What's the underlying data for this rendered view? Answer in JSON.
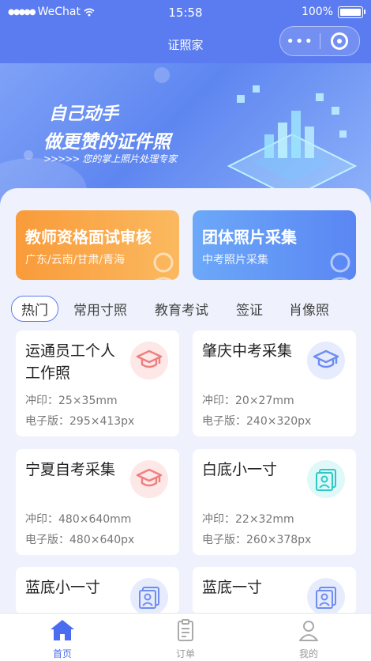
{
  "status": {
    "carrier": "WeChat",
    "time": "15:58",
    "battery": "100%"
  },
  "nav": {
    "title": "证照家",
    "more": "•••"
  },
  "banner": {
    "slogan_line1": "自己动手",
    "slogan_line2": "做更赞的证件照",
    "arrows": ">>>>>",
    "tagline": "您的掌上照片处理专家"
  },
  "promos": [
    {
      "title": "教师资格面试审核",
      "subtitle": "广东/云南/甘肃/青海",
      "color": "#f99b3a"
    },
    {
      "title": "团体照片采集",
      "subtitle": "中考照片采集",
      "color": "#5a86f3"
    }
  ],
  "tabs": [
    "热门",
    "常用寸照",
    "教育考试",
    "签证",
    "肖像照"
  ],
  "cards": [
    {
      "name": "运通员工个人工作照",
      "print": "冲印：25×35mm",
      "digital": "电子版：295×413px",
      "icon": "graduation-cap-icon",
      "icon_color": "#ef7f7f"
    },
    {
      "name": "肇庆中考采集",
      "print": "冲印：20×27mm",
      "digital": "电子版：240×320px",
      "icon": "graduation-cap-icon",
      "icon_color": "#6f8cf0"
    },
    {
      "name": "宁夏自考采集",
      "print": "冲印：480×640mm",
      "digital": "电子版：480×640px",
      "icon": "graduation-cap-icon",
      "icon_color": "#ef7f7f"
    },
    {
      "name": "白底小一寸",
      "print": "冲印：22×32mm",
      "digital": "电子版：260×378px",
      "icon": "id-photo-icon",
      "icon_color": "#2fc7c7"
    },
    {
      "name": "蓝底小一寸",
      "icon": "id-photo-icon",
      "icon_color": "#6f8cf0"
    },
    {
      "name": "蓝底一寸",
      "icon": "id-photo-icon",
      "icon_color": "#6f8cf0"
    }
  ],
  "tabbar": [
    {
      "label": "首页",
      "icon": "home-icon",
      "active": true
    },
    {
      "label": "订单",
      "icon": "order-icon",
      "active": false
    },
    {
      "label": "我的",
      "icon": "profile-icon",
      "active": false
    }
  ],
  "colors": {
    "accent": "#5b7cf0",
    "active_tab": "#4a6cf0"
  }
}
